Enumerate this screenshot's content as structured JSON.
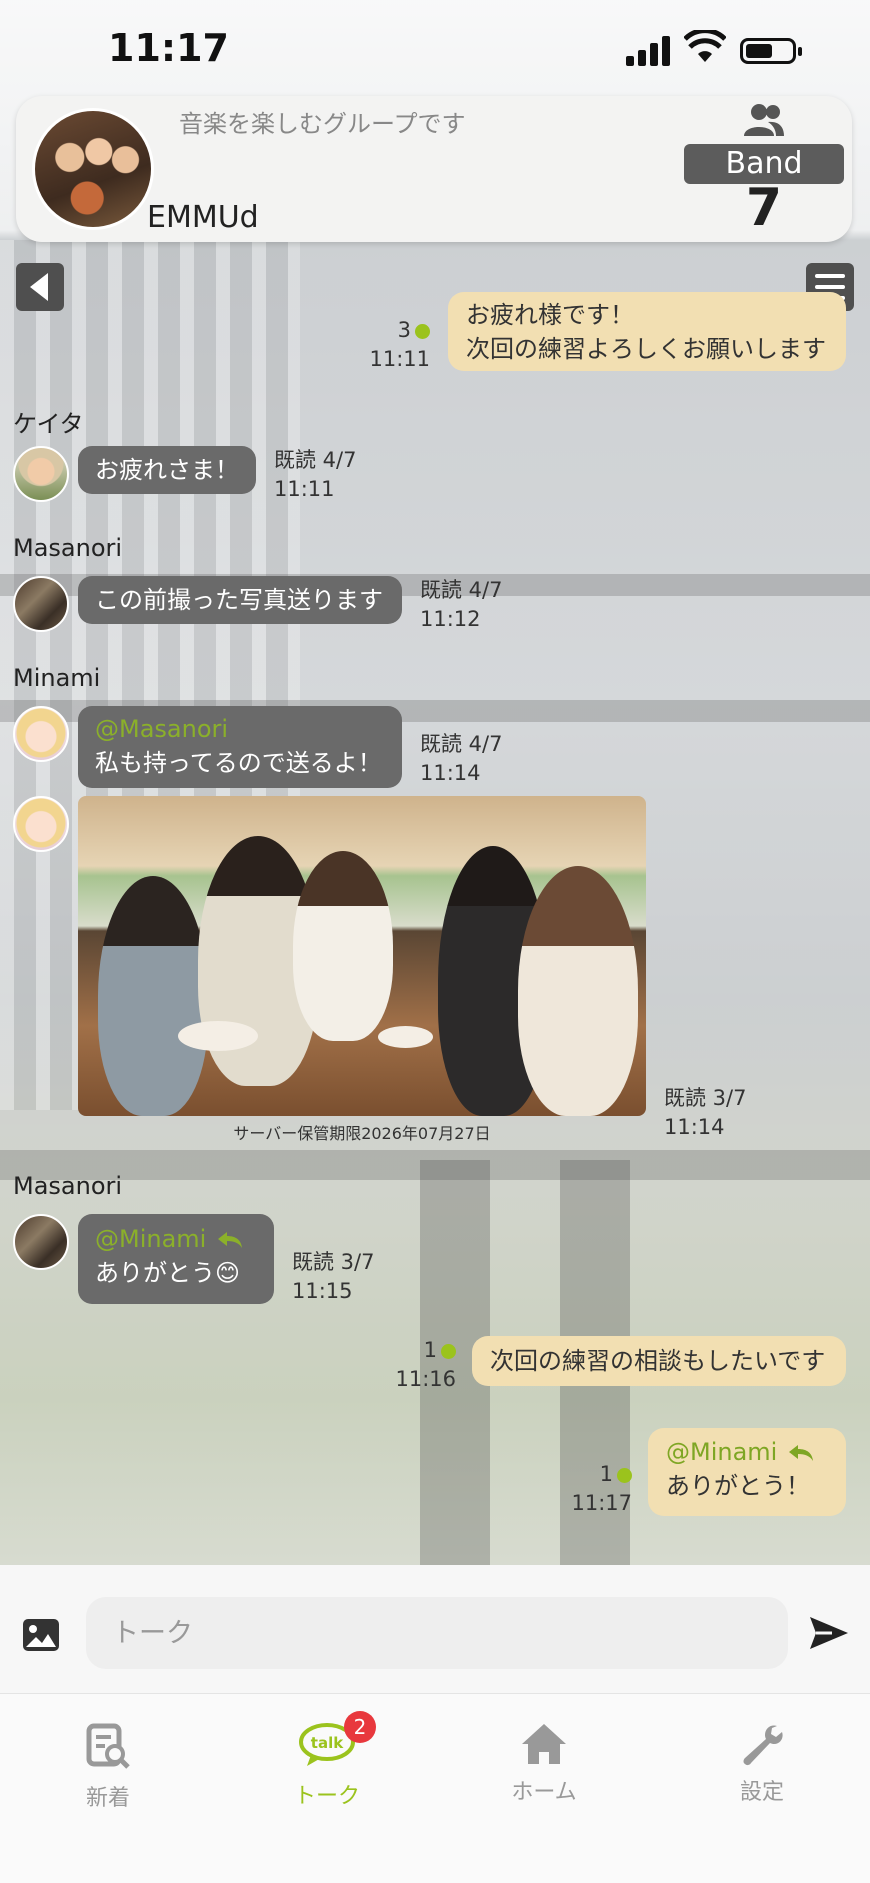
{
  "status_bar": {
    "time": "11:17"
  },
  "group": {
    "description": "音楽を楽しむグループです",
    "name": "EMMUd",
    "band_label": "Band",
    "member_count": "7"
  },
  "messages": [
    {
      "type": "out",
      "text_lines": [
        "お疲れ様です！",
        "次回の練習よろしくお願いします"
      ],
      "read_count": "3",
      "time": "11:11"
    },
    {
      "type": "in",
      "sender": "ケイタ",
      "text": "お疲れさま！",
      "read": "既読 4/7",
      "time": "11:11"
    },
    {
      "type": "in",
      "sender": "Masanori",
      "text": "この前撮った写真送ります",
      "read": "既読 4/7",
      "time": "11:12"
    },
    {
      "type": "in",
      "sender": "Minami",
      "mention": "@Masanori",
      "text": "私も持ってるので送るよ！",
      "read": "既読 4/7",
      "time": "11:14"
    },
    {
      "type": "in-image",
      "sender": "Minami",
      "caption": "サーバー保管期限2026年07月27日",
      "read": "既読 3/7",
      "time": "11:14"
    },
    {
      "type": "in",
      "sender": "Masanori",
      "mention": "@Minami",
      "text": "ありがとう😊",
      "read": "既読 3/7",
      "time": "11:15"
    },
    {
      "type": "out",
      "text": "次回の練習の相談もしたいです",
      "read_count": "1",
      "time": "11:16"
    },
    {
      "type": "out",
      "mention": "@Minami",
      "text": "ありがとう！",
      "read_count": "1",
      "time": "11:17"
    }
  ],
  "input": {
    "placeholder": "トーク"
  },
  "tabs": [
    {
      "label": "新着",
      "icon": "news-search-icon"
    },
    {
      "label": "トーク",
      "icon": "talk-bubble-icon",
      "badge": "2",
      "active": true
    },
    {
      "label": "ホーム",
      "icon": "home-icon"
    },
    {
      "label": "設定",
      "icon": "wrench-icon"
    }
  ],
  "colors": {
    "accent": "#9bc31d",
    "out_bubble": "#f2dfb2",
    "in_bubble": "#6a6a6a",
    "badge": "#e8383d"
  }
}
